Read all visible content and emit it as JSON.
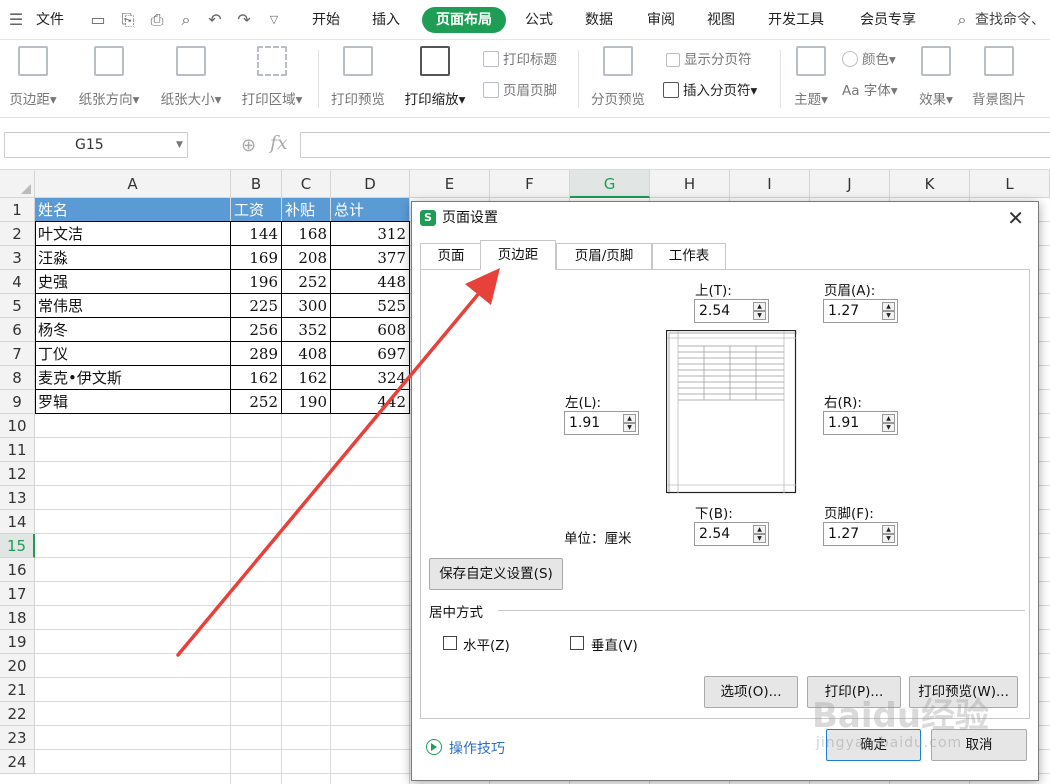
{
  "menubar": {
    "file": "文件",
    "tabs": [
      "开始",
      "插入",
      "页面布局",
      "公式",
      "数据",
      "审阅",
      "视图",
      "开发工具",
      "会员专享"
    ],
    "search": "查找命令、"
  },
  "ribbon": {
    "margins": "页边距",
    "orientation": "纸张方向",
    "size": "纸张大小",
    "print_area": "打印区域",
    "print_preview": "打印预览",
    "print_scale": "打印缩放",
    "print_titles": "打印标题",
    "header_footer": "页眉页脚",
    "page_break_preview": "分页预览",
    "show_page_breaks": "显示分页符",
    "insert_page_break": "插入分页符",
    "theme": "主题",
    "colors": "颜色",
    "fonts": "Aa 字体",
    "effects": "效果",
    "background": "背景图片"
  },
  "formula_bar": {
    "name_box": "G15",
    "fx": "fx"
  },
  "grid": {
    "columns": [
      "A",
      "B",
      "C",
      "D",
      "E",
      "F",
      "G",
      "H",
      "I",
      "J",
      "K",
      "L"
    ],
    "active_column": "G",
    "rows": [
      "1",
      "2",
      "3",
      "4",
      "5",
      "6",
      "7",
      "8",
      "9",
      "10",
      "11",
      "12",
      "13",
      "14",
      "15",
      "16",
      "17",
      "18",
      "19",
      "20",
      "21",
      "22",
      "23",
      "24"
    ],
    "active_row": "15",
    "table": {
      "header": [
        "姓名",
        "工资",
        "补贴",
        "总计"
      ],
      "rows": [
        [
          "叶文洁",
          "144",
          "168",
          "312"
        ],
        [
          "汪淼",
          "169",
          "208",
          "377"
        ],
        [
          "史强",
          "196",
          "252",
          "448"
        ],
        [
          "常伟思",
          "225",
          "300",
          "525"
        ],
        [
          "杨冬",
          "256",
          "352",
          "608"
        ],
        [
          "丁仪",
          "289",
          "408",
          "697"
        ],
        [
          "麦克•伊文斯",
          "162",
          "162",
          "324"
        ],
        [
          "罗辑",
          "252",
          "190",
          "442"
        ]
      ]
    },
    "header_color": "#5b9bd5"
  },
  "dialog": {
    "title": "页面设置",
    "tabs": [
      "页面",
      "页边距",
      "页眉/页脚",
      "工作表"
    ],
    "active_tab": "页边距",
    "top_label": "上(T):",
    "top": "2.54",
    "header_label": "页眉(A):",
    "header": "1.27",
    "left_label": "左(L):",
    "left": "1.91",
    "right_label": "右(R):",
    "right": "1.91",
    "bottom_label": "下(B):",
    "bottom": "2.54",
    "footer_label": "页脚(F):",
    "footer": "1.27",
    "unit": "单位：厘米",
    "save_custom": "保存自定义设置(S)",
    "center_title": "居中方式",
    "horizontal": "水平(Z)",
    "vertical": "垂直(V)",
    "options": "选项(O)...",
    "print": "打印(P)...",
    "print_preview": "打印预览(W)...",
    "tips": "操作技巧",
    "ok": "确定",
    "cancel": "取消"
  },
  "watermark": {
    "logo": "Baidu经验",
    "url": "jingyan.baidu.com"
  },
  "colors": {
    "accent": "#1e9d55",
    "arrow": "#e8413a"
  }
}
